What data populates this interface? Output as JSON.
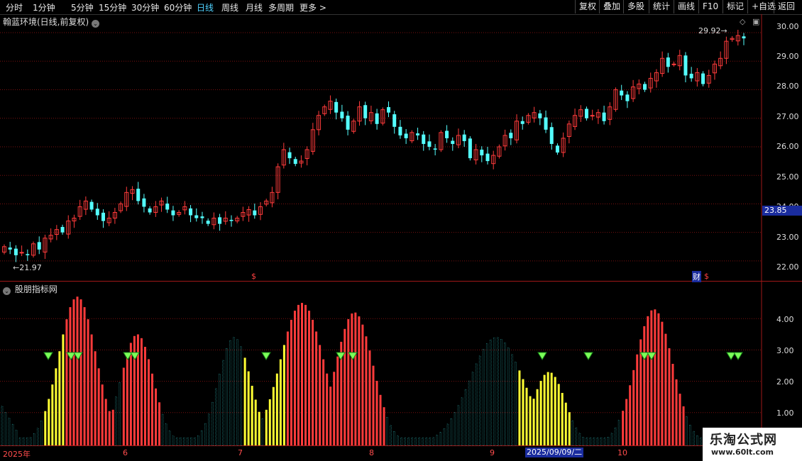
{
  "toolbar": {
    "periods": [
      "分时",
      "1分钟",
      "5分钟",
      "15分钟",
      "30分钟",
      "60分钟",
      "日线",
      "周线",
      "月线",
      "多周期",
      "更多 >"
    ],
    "active_period": "日线",
    "right_buttons": [
      "复权",
      "叠加",
      "多股",
      "统计",
      "画线",
      "F10",
      "标记",
      "+自选",
      "返回"
    ]
  },
  "main_chart": {
    "title": "翰蓝环境(日线,前复权)",
    "y_axis_labels": [
      "30.00",
      "29.00",
      "28.00",
      "27.00",
      "26.00",
      "25.00",
      "24.00",
      "23.00",
      "22.00"
    ],
    "current_price": "23.85",
    "high_marker": "29.92",
    "low_marker": "21.97",
    "event_marks": [
      "$",
      "财",
      "$"
    ]
  },
  "indicator_chart": {
    "title": "股朋指标网",
    "y_axis_labels": [
      "4.00",
      "3.00",
      "2.00",
      "1.00"
    ]
  },
  "date_axis": {
    "labels": [
      "2025年",
      "6",
      "7",
      "8",
      "9",
      "10"
    ],
    "cursor_date": "2025/09/09/二"
  },
  "watermark": {
    "title": "乐淘公式网",
    "url": "www.60lt.com"
  },
  "colors": {
    "up": "#ff3b3b",
    "down": "#54ffff",
    "yellow_bar": "#ffff33",
    "teal_bar": "#2aa6a6",
    "grid": "#7a1010",
    "diamond": "#7cff5a"
  },
  "chart_data": {
    "type": "candlestick",
    "price_ylim": [
      21.6,
      30.2
    ],
    "high": 29.92,
    "low": 21.97,
    "close_series": [
      22.5,
      22.4,
      22.2,
      22.3,
      22.2,
      22.6,
      22.4,
      22.8,
      22.9,
      23.1,
      23.0,
      23.4,
      23.5,
      23.9,
      24.1,
      23.8,
      23.6,
      23.4,
      23.5,
      23.7,
      24.0,
      24.4,
      24.5,
      24.1,
      23.9,
      23.7,
      23.9,
      24.1,
      23.8,
      23.6,
      23.7,
      23.9,
      23.6,
      23.5,
      23.5,
      23.3,
      23.5,
      23.3,
      23.5,
      23.4,
      23.5,
      23.7,
      23.8,
      23.6,
      23.9,
      24.1,
      24.4,
      25.3,
      25.9,
      25.6,
      25.4,
      25.5,
      25.9,
      26.6,
      27.1,
      27.4,
      27.6,
      27.2,
      27.0,
      26.6,
      26.9,
      27.4,
      27.0,
      27.2,
      26.8,
      27.3,
      27.2,
      26.7,
      26.4,
      26.3,
      26.5,
      26.4,
      26.1,
      26.0,
      25.9,
      26.5,
      26.3,
      26.1,
      26.4,
      26.2,
      25.6,
      25.9,
      25.7,
      25.5,
      25.7,
      26.0,
      26.4,
      26.3,
      26.9,
      26.8,
      27.1,
      27.2,
      27.0,
      26.6,
      26.1,
      25.8,
      26.3,
      26.8,
      27.1,
      27.3,
      27.0,
      27.1,
      27.2,
      26.9,
      27.4,
      28.0,
      27.8,
      27.6,
      28.1,
      28.2,
      28.0,
      28.4,
      28.6,
      29.1,
      28.8,
      28.9,
      29.2,
      28.5,
      28.4,
      28.6,
      28.2,
      28.5,
      28.9,
      29.1,
      29.7,
      29.8,
      29.9,
      29.8
    ]
  }
}
